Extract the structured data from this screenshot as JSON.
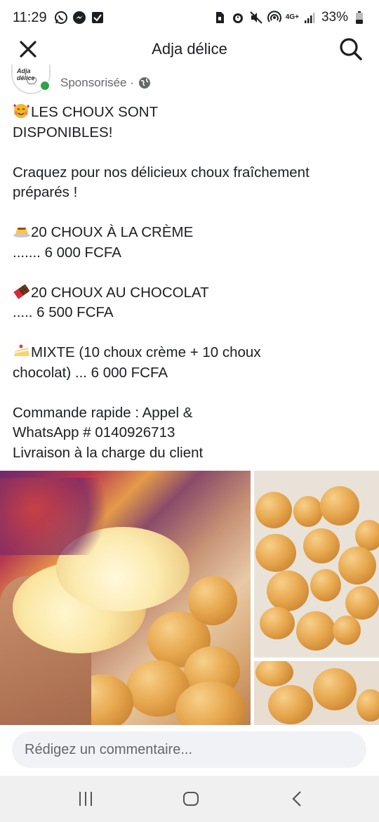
{
  "status_bar": {
    "time": "11:29",
    "battery": "33%",
    "network": "4G+"
  },
  "header": {
    "title": "Adja délice",
    "close_icon": "close-icon",
    "search_icon": "search-icon"
  },
  "post": {
    "avatar_logo_text": "Adja délice",
    "sponsored_label": "Sponsorisée ·",
    "lines": [
      "LES CHOUX SONT",
      "DISPONIBLES!",
      "",
      "Craquez pour nos délicieux choux fraîchement",
      "préparés !",
      "",
      "20 CHOUX À LA CRÈME",
      "....... 6 000 FCFA",
      "",
      "20 CHOUX AU CHOCOLAT",
      "..... 6 500 FCFA",
      "",
      "MIXTE (10 choux crème + 10 choux",
      "chocolat) ... 6 000 FCFA",
      "",
      "Commande rapide : Appel &",
      "WhatsApp # 0140926713",
      "Livraison à la charge du client"
    ],
    "emojis": {
      "title": "smiling-face-with-hearts-emoji",
      "creme": "custard-emoji",
      "chocolat": "chocolate-bar-emoji",
      "mixte": "shortcake-emoji"
    }
  },
  "comment": {
    "placeholder": "Rédigez un commentaire..."
  },
  "nav": {
    "recents_icon": "recents-icon",
    "home_icon": "home-icon",
    "back_icon": "back-icon"
  },
  "colors": {
    "online": "#31a24c",
    "secondary_text": "#65676b",
    "input_bg": "#f0f2f5"
  }
}
